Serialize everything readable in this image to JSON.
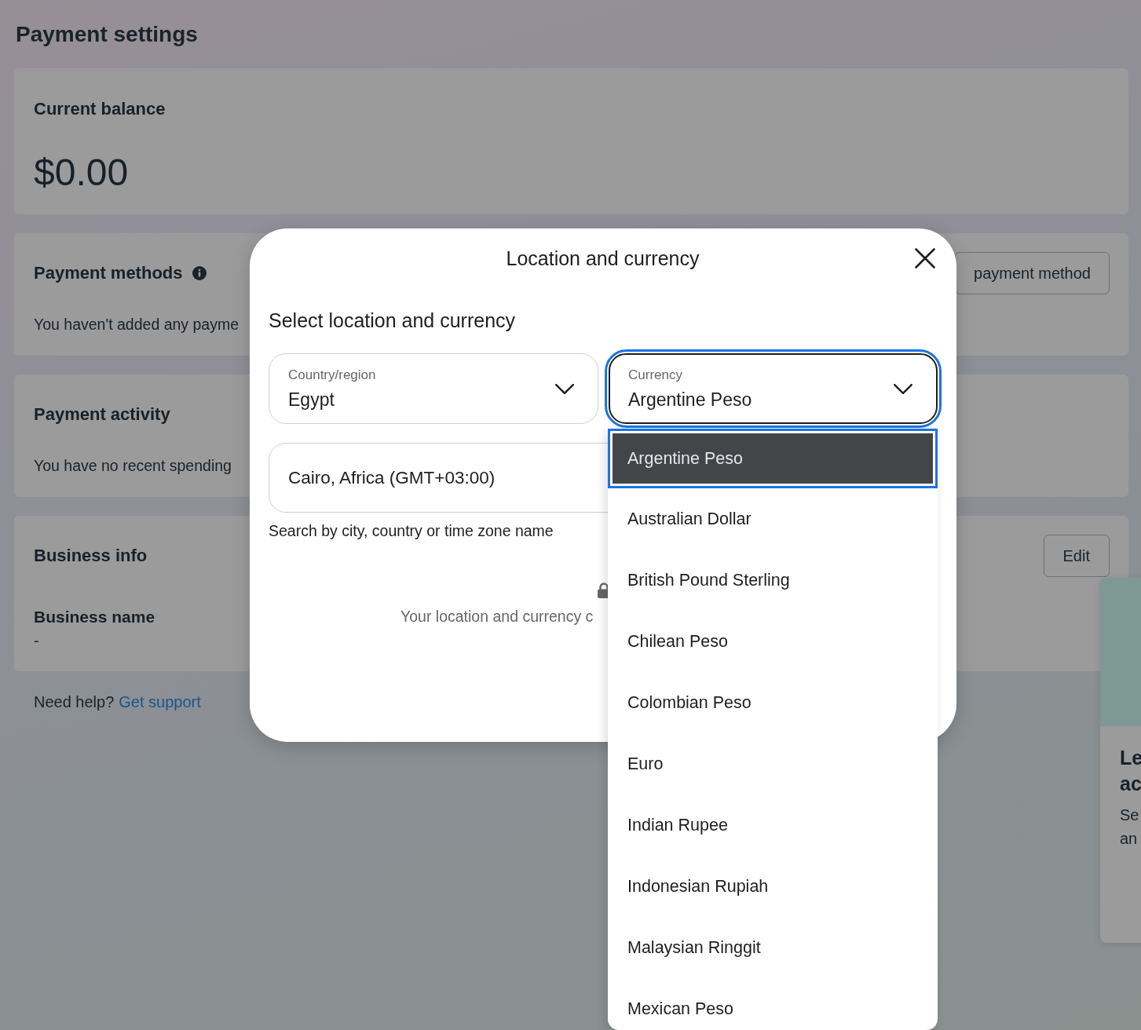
{
  "page": {
    "title": "Payment settings"
  },
  "balance_card": {
    "title": "Current balance",
    "amount": "$0.00"
  },
  "payment_methods_card": {
    "title": "Payment methods",
    "button": "payment method",
    "message": "You haven't added any payme"
  },
  "payment_activity_card": {
    "title": "Payment activity",
    "message": "You have no recent spending"
  },
  "business_info_card": {
    "title": "Business info",
    "button": "Edit",
    "field_label": "Business name",
    "field_value": "-"
  },
  "help": {
    "text": "Need help?",
    "link": "Get support"
  },
  "side_card": {
    "heading_lines": [
      "Le",
      "ac"
    ],
    "body_lines": [
      "Se",
      "an"
    ]
  },
  "modal": {
    "title": "Location and currency",
    "subtitle": "Select location and currency",
    "country_field": {
      "label": "Country/region",
      "value": "Egypt"
    },
    "currency_field": {
      "label": "Currency",
      "value": "Argentine Peso",
      "expanded": true
    },
    "timezone_field": {
      "value": "Cairo, Africa (GMT+03:00)",
      "helper": "Search by city, country or time zone name"
    },
    "notice": "Your location and currency c",
    "currency_options": [
      {
        "label": "Argentine Peso",
        "selected": true
      },
      {
        "label": "Australian Dollar",
        "selected": false
      },
      {
        "label": "British Pound Sterling",
        "selected": false
      },
      {
        "label": "Chilean Peso",
        "selected": false
      },
      {
        "label": "Colombian Peso",
        "selected": false
      },
      {
        "label": "Euro",
        "selected": false
      },
      {
        "label": "Indian Rupee",
        "selected": false
      },
      {
        "label": "Indonesian Rupiah",
        "selected": false
      },
      {
        "label": "Malaysian Ringgit",
        "selected": false
      },
      {
        "label": "Mexican Peso",
        "selected": false
      }
    ]
  }
}
